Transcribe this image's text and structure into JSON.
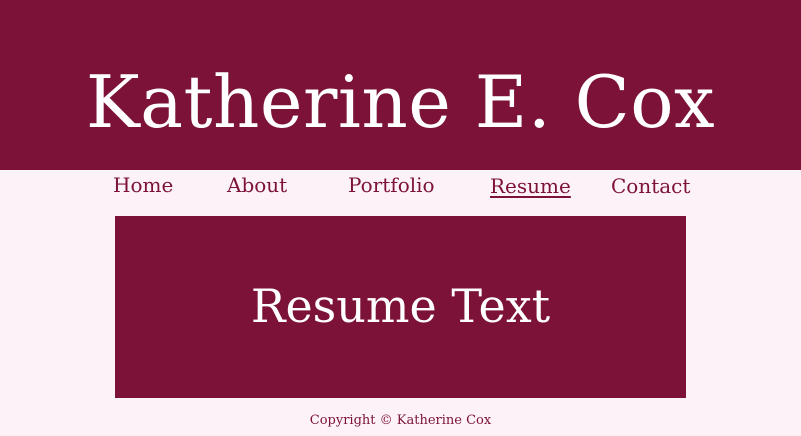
{
  "header": {
    "site_title": "Katherine E. Cox"
  },
  "nav": {
    "items": [
      {
        "label": "Home"
      },
      {
        "label": "About"
      },
      {
        "label": "Portfolio"
      },
      {
        "label": "Resume",
        "active": true
      },
      {
        "label": "Contact"
      }
    ]
  },
  "main": {
    "content_text": "Resume Text"
  },
  "footer": {
    "copyright": "Copyright © Katherine Cox"
  },
  "colors": {
    "brand": "#7c1238",
    "background": "#fdf2f7",
    "text_on_brand": "#ffffff"
  }
}
